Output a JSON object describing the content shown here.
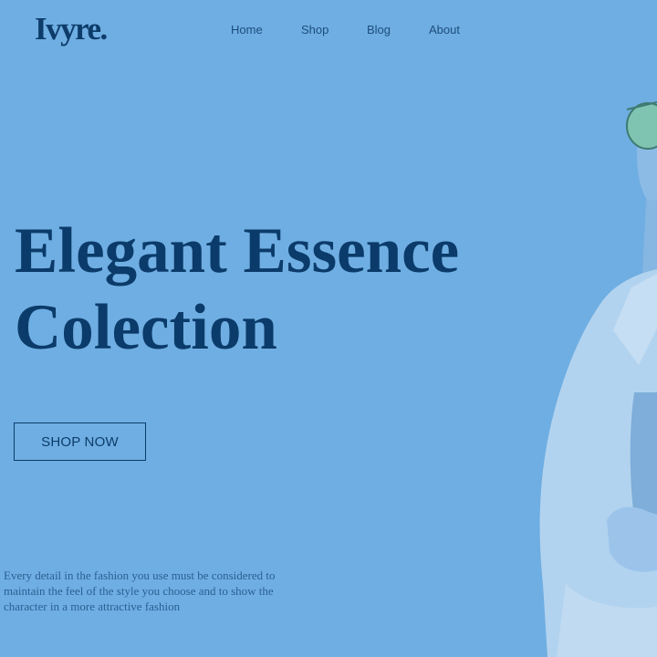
{
  "brand": {
    "logo": "Ivyre."
  },
  "nav": {
    "items": [
      {
        "label": "Home"
      },
      {
        "label": "Shop"
      },
      {
        "label": "Blog"
      },
      {
        "label": "About"
      }
    ]
  },
  "hero": {
    "title_line1": "Elegant Essence",
    "title_line2": "Colection",
    "cta_label": "SHOP NOW",
    "description": "Every detail in the fashion you use must be considered to maintain the feel of the style you choose and to show the character in a more attractive fashion",
    "image_subject": "model-in-white-shirt-and-sunglasses"
  },
  "colors": {
    "background": "#6faee2",
    "primary": "#0d3c6b",
    "body_text": "#2b5f92"
  }
}
